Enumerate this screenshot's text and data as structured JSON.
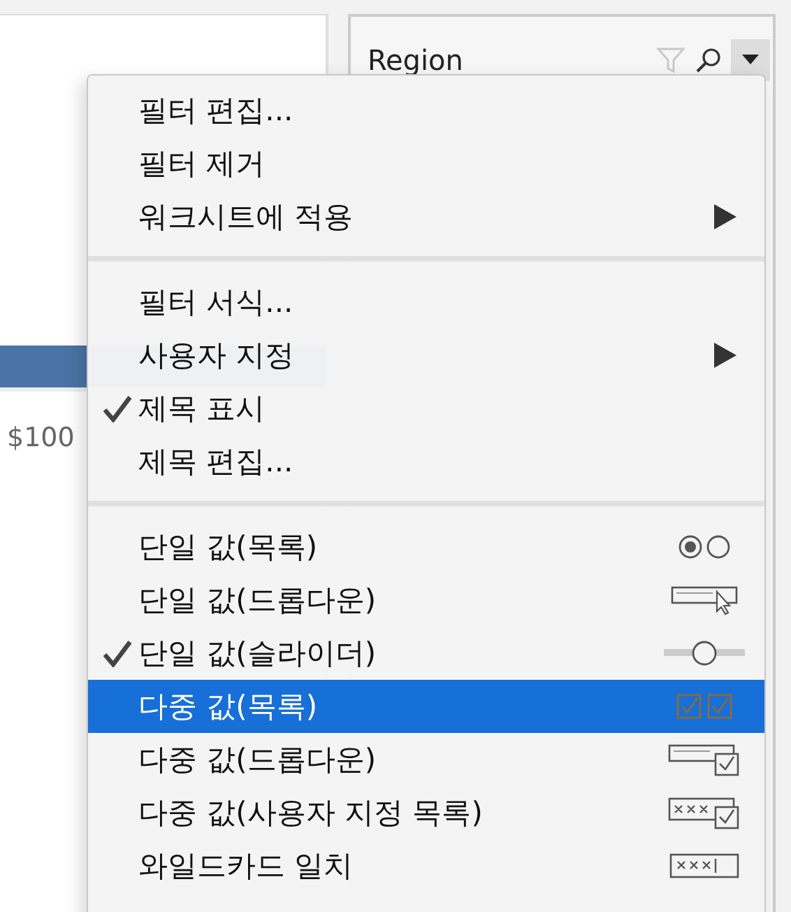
{
  "left_panel": {
    "axis_label": "$100"
  },
  "filter_card": {
    "title": "Region"
  },
  "menu": {
    "sections": [
      [
        {
          "label": "필터 편집...",
          "checked": false,
          "selected": false,
          "submenu": false
        },
        {
          "label": "필터 제거",
          "checked": false,
          "selected": false,
          "submenu": false
        },
        {
          "label": "워크시트에 적용",
          "checked": false,
          "selected": false,
          "submenu": true
        }
      ],
      [
        {
          "label": "필터 서식...",
          "checked": false,
          "selected": false,
          "submenu": false
        },
        {
          "label": "사용자 지정",
          "checked": false,
          "selected": false,
          "submenu": true
        },
        {
          "label": "제목 표시",
          "checked": true,
          "selected": false,
          "submenu": false
        },
        {
          "label": "제목 편집...",
          "checked": false,
          "selected": false,
          "submenu": false
        }
      ],
      [
        {
          "label": "단일 값(목록)",
          "checked": false,
          "selected": false,
          "submenu": false,
          "kind": "radio-list"
        },
        {
          "label": "단일 값(드롭다운)",
          "checked": false,
          "selected": false,
          "submenu": false,
          "kind": "dropdown"
        },
        {
          "label": "단일 값(슬라이더)",
          "checked": true,
          "selected": false,
          "submenu": false,
          "kind": "slider"
        },
        {
          "label": "다중 값(목록)",
          "checked": false,
          "selected": true,
          "submenu": false,
          "kind": "checkbox-list"
        },
        {
          "label": "다중 값(드롭다운)",
          "checked": false,
          "selected": false,
          "submenu": false,
          "kind": "checkbox-dropdown"
        },
        {
          "label": "다중 값(사용자 지정 목록)",
          "checked": false,
          "selected": false,
          "submenu": false,
          "kind": "custom-list"
        },
        {
          "label": "와일드카드 일치",
          "checked": false,
          "selected": false,
          "submenu": false,
          "kind": "wildcard"
        }
      ]
    ]
  }
}
